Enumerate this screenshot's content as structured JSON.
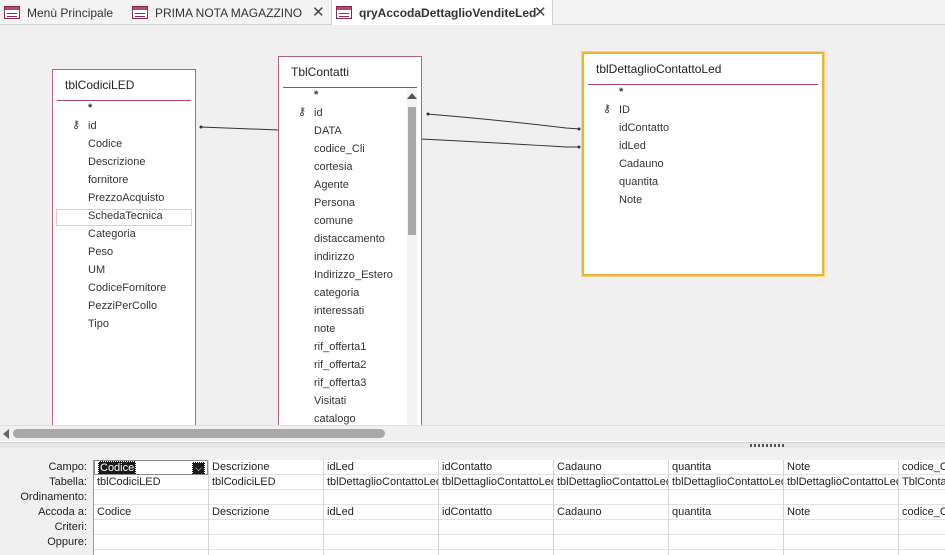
{
  "tabs": [
    {
      "label": "Menù Principale",
      "active": false
    },
    {
      "label": "PRIMA NOTA MAGAZZINO",
      "active": false,
      "close": "✕"
    },
    {
      "label": "qryAccodaDettaglioVenditeLed",
      "active": true,
      "close": "✕"
    }
  ],
  "tables": {
    "codici": {
      "title": "tblCodiciLED",
      "fields": [
        "*",
        "id",
        "Codice",
        "Descrizione",
        "fornitore",
        "PrezzoAcquisto",
        "SchedaTecnica",
        "Categoria",
        "Peso",
        "UM",
        "CodiceFornitore",
        "PezziPerCollo",
        "Tipo"
      ],
      "key_field": "id",
      "highlighted_field": "SchedaTecnica"
    },
    "contatti": {
      "title": "TblContatti",
      "fields": [
        "*",
        "id",
        "DATA",
        "codice_Cli",
        "cortesia",
        "Agente",
        "Persona",
        "comune",
        "distaccamento",
        "indirizzo",
        "Indirizzo_Estero",
        "categoria",
        "interessati",
        "note",
        "rif_offerta1",
        "rif_offerta2",
        "rif_offerta3",
        "Visitati",
        "catalogo"
      ],
      "key_field": "id"
    },
    "dettaglio": {
      "title": "tblDettaglioContattoLed",
      "fields": [
        "*",
        "ID",
        "idContatto",
        "idLed",
        "Cadauno",
        "quantita",
        "Note"
      ],
      "key_field": "ID"
    }
  },
  "grid": {
    "row_labels": [
      "Campo:",
      "Tabella:",
      "Ordinamento:",
      "Accoda a:",
      "Criteri:",
      "Oppure:"
    ],
    "columns": [
      {
        "campo": "Codice",
        "tabella": "tblCodiciLED",
        "accoda": "Codice"
      },
      {
        "campo": "Descrizione",
        "tabella": "tblCodiciLED",
        "accoda": "Descrizione"
      },
      {
        "campo": "idLed",
        "tabella": "tblDettaglioContattoLed",
        "accoda": "idLed"
      },
      {
        "campo": "idContatto",
        "tabella": "tblDettaglioContattoLed",
        "accoda": "idContatto"
      },
      {
        "campo": "Cadauno",
        "tabella": "tblDettaglioContattoLed",
        "accoda": "Cadauno"
      },
      {
        "campo": "quantita",
        "tabella": "tblDettaglioContattoLed",
        "accoda": "quantita"
      },
      {
        "campo": "Note",
        "tabella": "tblDettaglioContattoLed",
        "accoda": "Note"
      },
      {
        "campo": "codice_Cli",
        "tabella": "TblContatti",
        "accoda": "codice_Cli"
      }
    ]
  },
  "icons": {
    "key": "key-icon",
    "dropdown": "chevron-down-icon",
    "table_tab": "table-icon"
  }
}
